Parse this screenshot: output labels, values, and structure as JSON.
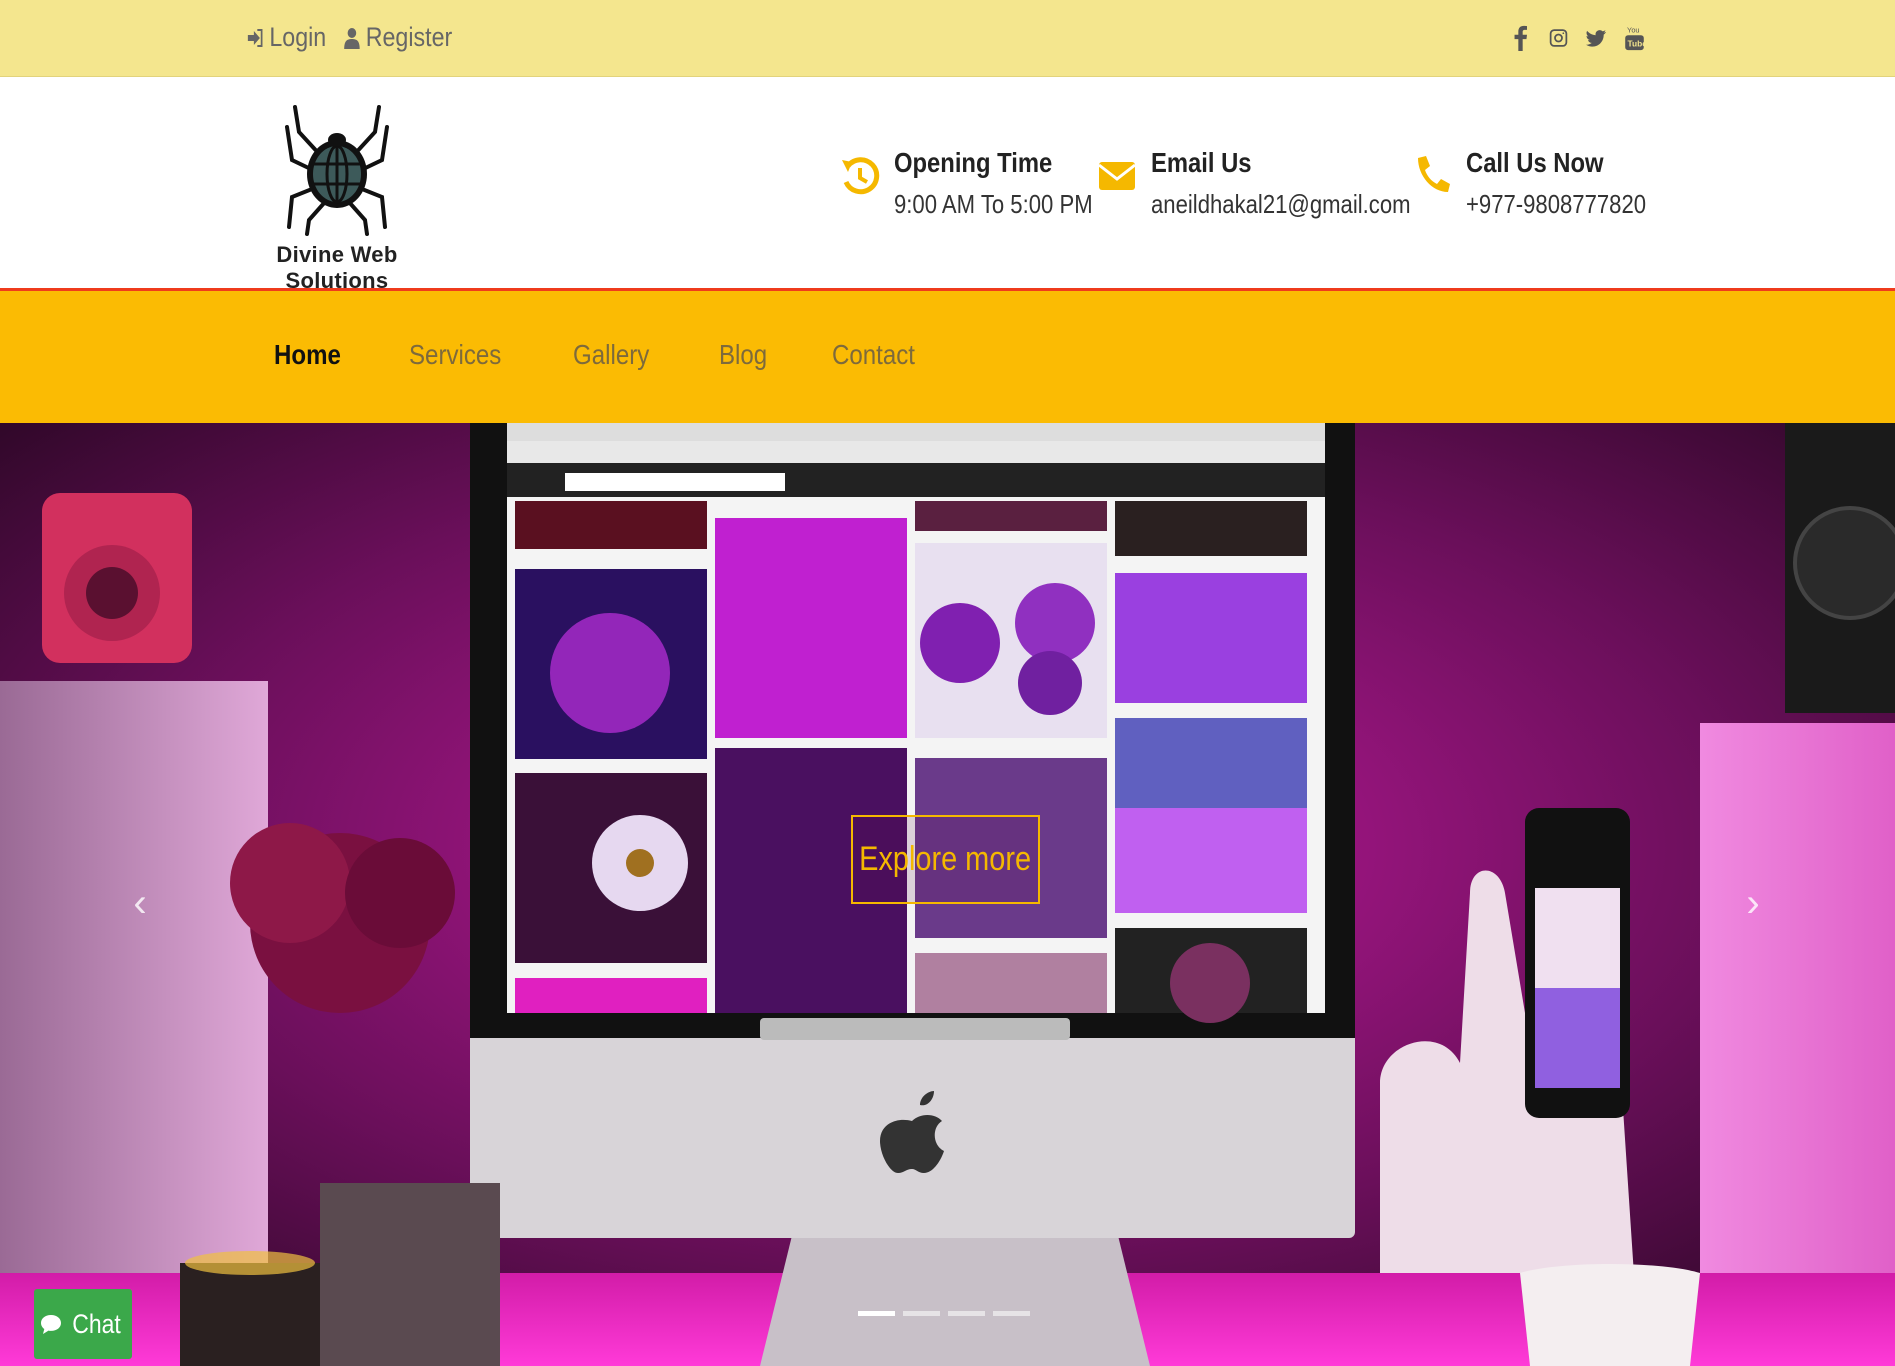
{
  "topbar": {
    "login_label": "Login",
    "register_label": "Register",
    "social_icons": [
      "facebook-icon",
      "instagram-icon",
      "twitter-icon",
      "youtube-icon"
    ]
  },
  "header": {
    "logo_text": "Divine Web Solutions",
    "opening": {
      "title": "Opening Time",
      "value": "9:00 AM To 5:00 PM"
    },
    "email": {
      "title": "Email Us",
      "value": "aneildhakal21@gmail.com"
    },
    "phone": {
      "title": "Call Us Now",
      "value": "+977-9808777820"
    }
  },
  "nav": {
    "items": [
      "Home",
      "Services",
      "Gallery",
      "Blog",
      "Contact"
    ],
    "active": "Home"
  },
  "hero": {
    "button_label": "Explore more",
    "slides_count": 4,
    "active_slide": 1
  },
  "chat": {
    "label": "Chat"
  },
  "colors": {
    "topbar_bg": "#f4e68e",
    "nav_bg": "#fbbb03",
    "accent": "#f5b800",
    "header_border": "#ef3b1c",
    "chat_bg": "#3ba84a"
  }
}
